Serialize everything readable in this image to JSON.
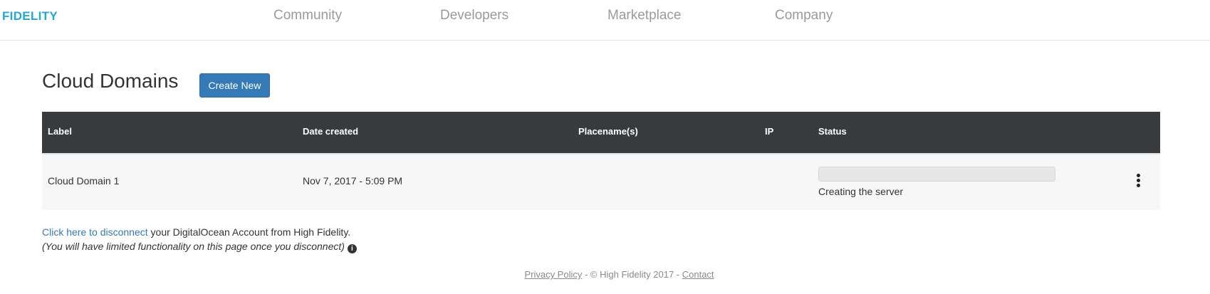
{
  "header": {
    "brand": "FIDELITY",
    "nav": {
      "community": "Community",
      "developers": "Developers",
      "marketplace": "Marketplace",
      "company": "Company"
    }
  },
  "page": {
    "title": "Cloud Domains",
    "create_button": "Create New"
  },
  "table": {
    "columns": {
      "label": "Label",
      "date": "Date created",
      "placenames": "Placename(s)",
      "ip": "IP",
      "status": "Status"
    },
    "rows": [
      {
        "label": "Cloud Domain 1",
        "date": "Nov 7, 2017 - 5:09 PM",
        "placenames": "",
        "ip": "",
        "status_text": "Creating the server",
        "progress": 0
      }
    ]
  },
  "disconnect": {
    "link": "Click here to disconnect",
    "rest": " your DigitalOcean Account from High Fidelity.",
    "note": "(You will have limited functionality on this page once you disconnect)"
  },
  "footer": {
    "privacy": "Privacy Policy",
    "copyright": " - © High Fidelity 2017 - ",
    "contact": "Contact"
  },
  "colors": {
    "brand": "#1fa8d8",
    "primary_button": "#337ab7",
    "table_header": "#383b3e"
  },
  "icons": {
    "info": "info-circle-icon",
    "menu": "kebab-menu-icon"
  }
}
